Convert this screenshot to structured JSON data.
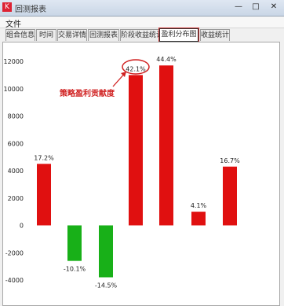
{
  "window": {
    "title": "回测报表",
    "minimize": "—",
    "maximize": "□",
    "close": "✕",
    "app_icon": "app-icon"
  },
  "menu": {
    "file": "文件"
  },
  "tabs": [
    {
      "label": "组合信息"
    },
    {
      "label": "时间"
    },
    {
      "label": "交易详情"
    },
    {
      "label": "回测报表"
    },
    {
      "label": "阶段收益统计"
    },
    {
      "label": "盈利分布图"
    },
    {
      "label": "收益统计"
    }
  ],
  "annotation": {
    "text": "策略盈利贡献度"
  },
  "chart_data": {
    "type": "bar",
    "ylim": [
      -4000,
      12000
    ],
    "yticks": [
      -4000,
      -2000,
      0,
      2000,
      4000,
      6000,
      8000,
      10000,
      12000
    ],
    "values": [
      4500,
      -2600,
      -3800,
      11000,
      11700,
      1000,
      4300
    ],
    "labels": [
      "17.2%",
      "-10.1%",
      "-14.5%",
      "42.1%",
      "44.4%",
      "4.1%",
      "16.7%"
    ],
    "colors": {
      "positive": "#e01010",
      "negative": "#18b018",
      "annotation": "#d02020"
    }
  }
}
